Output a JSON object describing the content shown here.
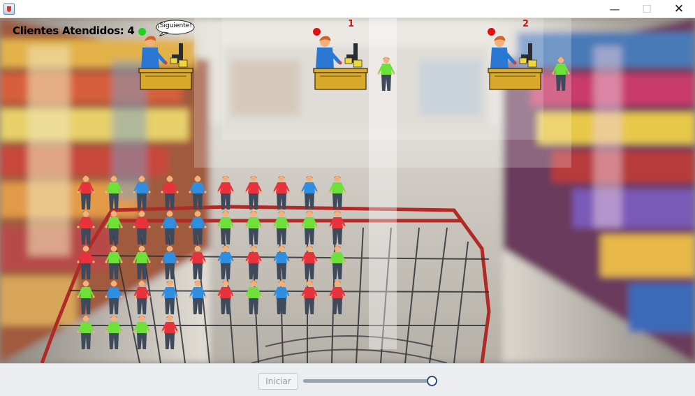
{
  "window": {
    "minimize_glyph": "—",
    "maximize_glyph": "☐",
    "close_glyph": "✕"
  },
  "counter": {
    "label": "Clientes Atendidos: ",
    "value": "4"
  },
  "speech_bubble": "¡Siguiente!",
  "registers": [
    {
      "number": "",
      "status_color": "#1ed31e",
      "has_customer": false
    },
    {
      "number": "1",
      "status_color": "#e01010",
      "has_customer": true
    },
    {
      "number": "2",
      "status_color": "#e01010",
      "has_customer": true
    }
  ],
  "queue": {
    "rows": [
      [
        "red",
        "green",
        "blue",
        "red",
        "blue",
        "red",
        "red",
        "red",
        "blue",
        "green"
      ],
      [
        "red",
        "green",
        "red",
        "blue",
        "blue",
        "green",
        "green",
        "green",
        "green",
        "red"
      ],
      [
        "red",
        "green",
        "green",
        "blue",
        "red",
        "blue",
        "red",
        "blue",
        "red",
        "green"
      ],
      [
        "green",
        "blue",
        "red",
        "blue",
        "blue",
        "red",
        "green",
        "blue",
        "red",
        "red"
      ],
      [
        "green",
        "green",
        "green",
        "red"
      ]
    ]
  },
  "colors": {
    "red": "#e8323c",
    "green": "#6ee03a",
    "blue": "#2f8ee0",
    "cashier_shirt": "#2a78d4",
    "counter_wood": "#d8a92a"
  },
  "controls": {
    "start_label": "Iniciar",
    "speed_fraction": 0.97
  }
}
